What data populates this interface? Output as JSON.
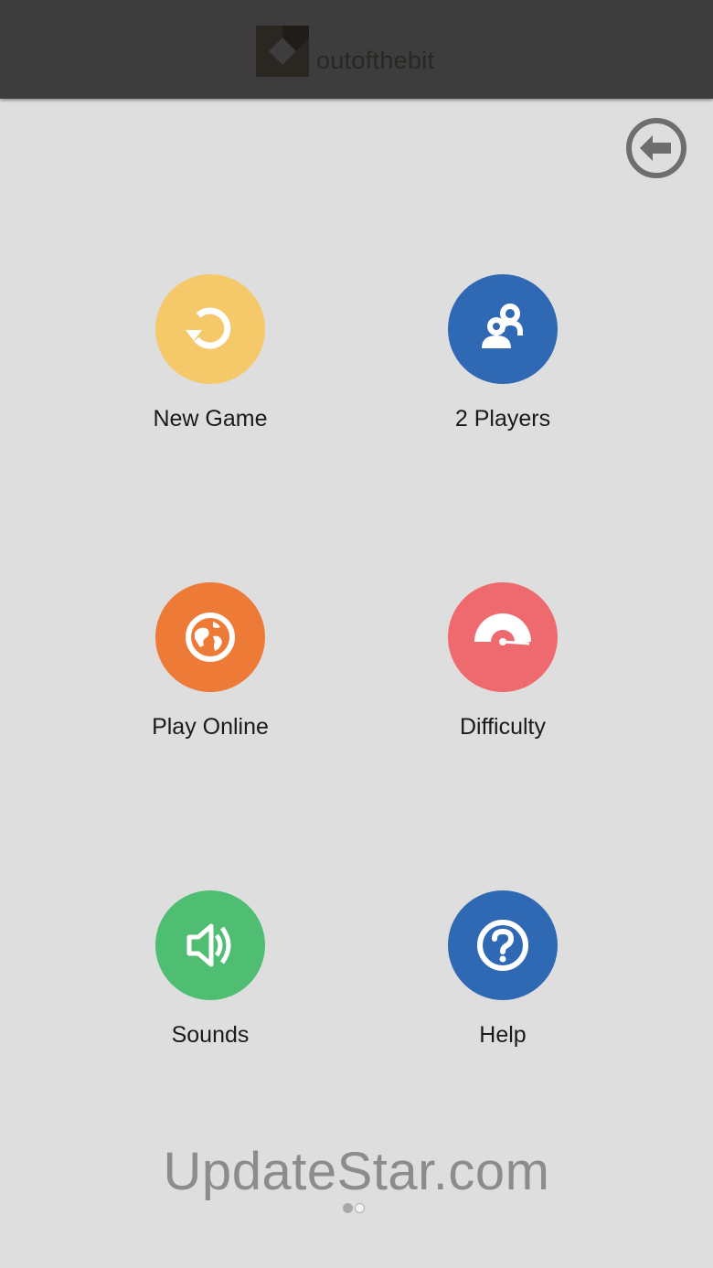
{
  "header": {
    "brand_name": "outofthebit",
    "background_color": "#3d3d3d"
  },
  "back_button": {
    "icon": "arrow-left-circle-icon"
  },
  "menu": [
    {
      "label": "New Game",
      "icon": "restart-icon",
      "color": "#f5c86a"
    },
    {
      "label": "2 Players",
      "icon": "two-players-icon",
      "color": "#2f69b4"
    },
    {
      "label": "Play Online",
      "icon": "globe-icon",
      "color": "#ee7a37"
    },
    {
      "label": "Difficulty",
      "icon": "gauge-icon",
      "color": "#ef6a6e"
    },
    {
      "label": "Sounds",
      "icon": "speaker-icon",
      "color": "#4fbd72"
    },
    {
      "label": "Help",
      "icon": "question-icon",
      "color": "#2f69b4"
    }
  ],
  "watermark": "UpdateStar.com",
  "pager": {
    "pages": 2,
    "current": 1
  }
}
